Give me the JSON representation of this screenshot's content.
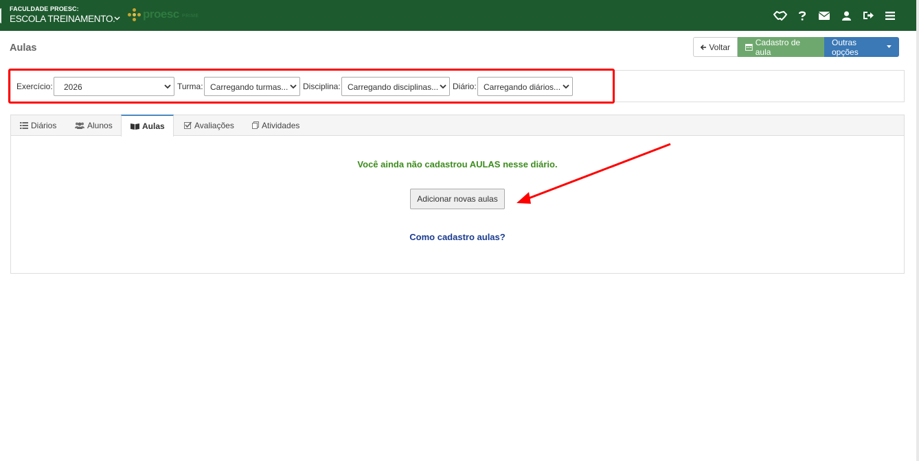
{
  "topbar": {
    "institution_small": "FACULDADE PROESC:",
    "institution_name": "ESCOLA TREINAMENTO.",
    "logo_text": "proesc",
    "logo_sub": "PRIME",
    "icons": [
      "handshake-icon",
      "question-icon",
      "envelope-icon",
      "user-icon",
      "logout-icon",
      "menu-icon"
    ],
    "bg_color": "#1d5a2e"
  },
  "page": {
    "title": "Aulas",
    "buttons": {
      "voltar": "Voltar",
      "cadastro": "Cadastro de aula",
      "outras": "Outras opções"
    }
  },
  "filters": {
    "exercicio_label": "Exercício:",
    "exercicio_value": "2026",
    "turma_label": "Turma:",
    "turma_value": "Carregando turmas...",
    "disciplina_label": "Disciplina:",
    "disciplina_value": "Carregando disciplinas...",
    "diario_label": "Diário:",
    "diario_value": "Carregando diários..."
  },
  "tabs": [
    {
      "label": "Diários",
      "icon": "list-icon"
    },
    {
      "label": "Alunos",
      "icon": "users-icon"
    },
    {
      "label": "Aulas",
      "icon": "book-icon",
      "active": true
    },
    {
      "label": "Avaliações",
      "icon": "checkbox-icon"
    },
    {
      "label": "Atividades",
      "icon": "copy-icon"
    }
  ],
  "content": {
    "empty_message": "Você ainda não cadastrou AULAS nesse diário.",
    "add_button": "Adicionar novas aulas",
    "help_link": "Como cadastro aulas?"
  },
  "colors": {
    "accent_red": "#ff0000",
    "success_green": "#3c8c1c",
    "link_blue": "#1a3b8f"
  }
}
